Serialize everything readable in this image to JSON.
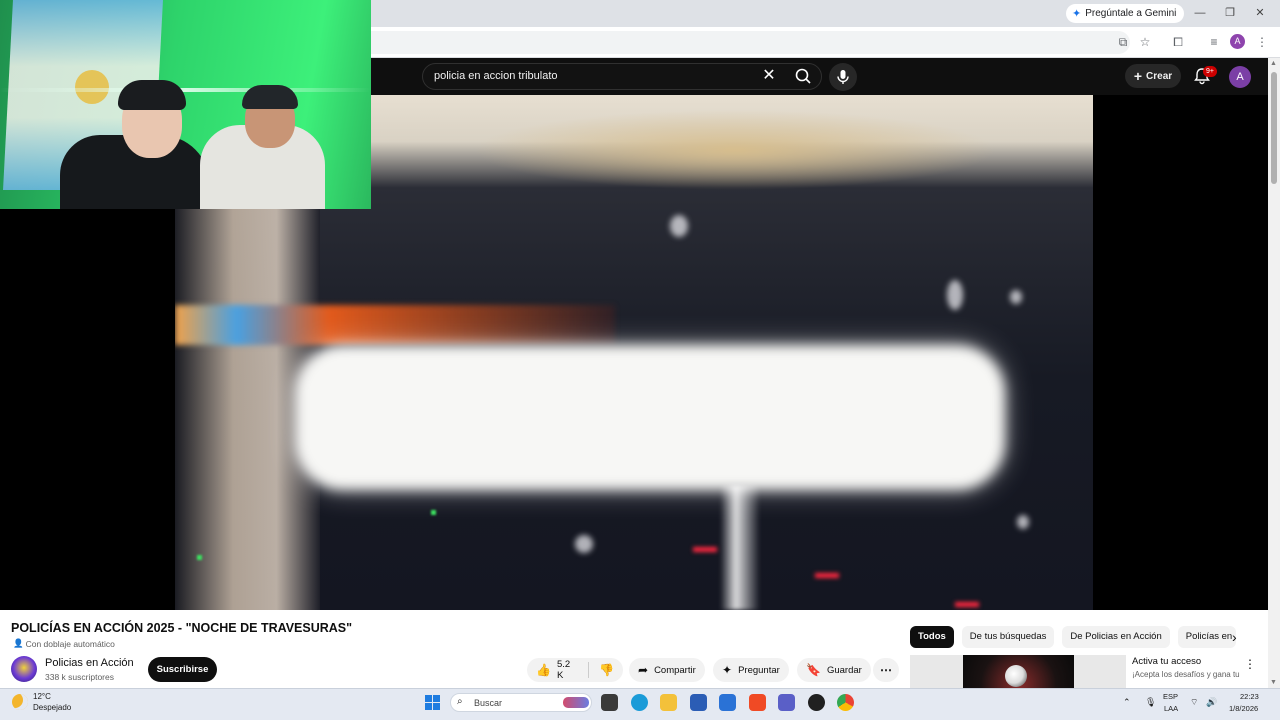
{
  "browser": {
    "gemini_label": "Pregúntale a Gemini",
    "profile_initial": "A"
  },
  "youtube": {
    "search_query": "policia en accion tribulato",
    "create_label": "Crear",
    "notif_count": "9+",
    "avatar_initial": "A"
  },
  "video": {
    "title": "POLICÍAS EN ACCIÓN 2025 - \"NOCHE DE TRAVESURAS\"",
    "dubbing_label": "Con doblaje automático",
    "channel_name": "Policias en Acción",
    "subscribers": "338 k suscriptores",
    "subscribe_label": "Suscribirse",
    "likes": "5.2 K",
    "share_label": "Compartir",
    "ask_label": "Preguntar",
    "save_label": "Guardar"
  },
  "chips": [
    "Todos",
    "De tus búsquedas",
    "De Policias en Acción",
    "Policías en"
  ],
  "recommendation": {
    "title": "Activa tu acceso",
    "subtitle": "¡Acepta los desafíos y gana tu"
  },
  "taskbar": {
    "temperature": "12°C",
    "weather": "Despejado",
    "search_placeholder": "Buscar",
    "lang_top": "ESP",
    "lang_bottom": "LAA",
    "time": "22:23",
    "date": "1/8/2026"
  },
  "colors": {
    "yt_dark": "#0f0f0f",
    "notif_red": "#cc0000",
    "avatar_purple": "#7b3fa6",
    "webcam_green": "#2ed46b",
    "win_blue": "#1e7ce0"
  }
}
